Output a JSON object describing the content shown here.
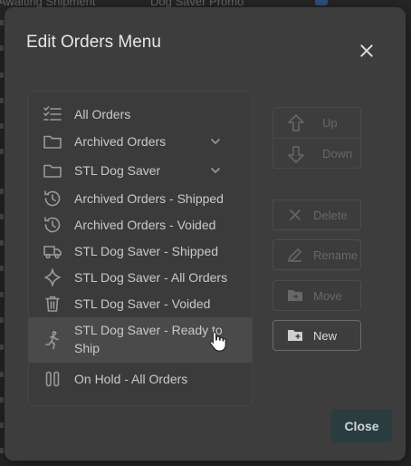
{
  "background": {
    "texts": [
      "Awaiting Shipment",
      "Dog Saver Promo"
    ]
  },
  "modal": {
    "title": "Edit Orders Menu",
    "close_icon": "close-icon",
    "list": [
      {
        "label": "All Orders",
        "icon": "checklist-icon",
        "expandable": false
      },
      {
        "label": "Archived Orders",
        "icon": "folder-icon",
        "expandable": true
      },
      {
        "label": "STL Dog Saver",
        "icon": "folder-icon",
        "expandable": true
      },
      {
        "label": "Archived Orders - Shipped",
        "icon": "history-icon",
        "expandable": false
      },
      {
        "label": "Archived Orders - Voided",
        "icon": "history-icon",
        "expandable": false
      },
      {
        "label": "STL Dog Saver - Shipped",
        "icon": "truck-icon",
        "expandable": false
      },
      {
        "label": "STL Dog Saver - All Orders",
        "icon": "sparkle-icon",
        "expandable": false
      },
      {
        "label": "STL Dog Saver - Voided",
        "icon": "trash-icon",
        "expandable": false
      },
      {
        "label": "STL Dog Saver - Ready to Ship",
        "icon": "running-person-icon",
        "expandable": false,
        "hovered": true
      },
      {
        "label": "On Hold - All Orders",
        "icon": "pause-icon",
        "expandable": false
      }
    ],
    "actions": {
      "up": "Up",
      "down": "Down",
      "delete": "Delete",
      "rename": "Rename",
      "move": "Move",
      "new": "New"
    },
    "close_button": "Close"
  },
  "colors": {
    "modal_bg": "#3d3d3d",
    "close_button_bg": "#2b3c40",
    "hover_row": "#4a4a4a"
  }
}
